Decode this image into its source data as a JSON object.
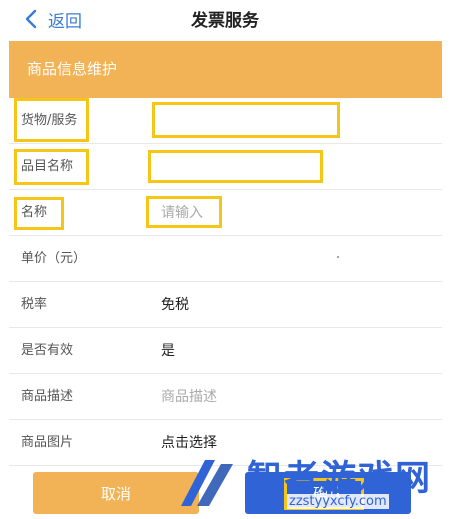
{
  "nav": {
    "back_label": "返回",
    "title": "发票服务"
  },
  "section": {
    "title": "商品信息维护"
  },
  "form": {
    "rows": [
      {
        "label": "货物/服务",
        "value": "",
        "placeholder": ""
      },
      {
        "label": "品目名称",
        "value": "",
        "placeholder": ""
      },
      {
        "label": "名称",
        "value": "",
        "placeholder": "请输入"
      },
      {
        "label": "单价（元）",
        "value": "",
        "placeholder": ""
      },
      {
        "label": "税率",
        "value": "免税",
        "placeholder": ""
      },
      {
        "label": "是否有效",
        "value": "是",
        "placeholder": ""
      },
      {
        "label": "商品描述",
        "value": "",
        "placeholder": "商品描述"
      },
      {
        "label": "商品图片",
        "value": "点击选择",
        "placeholder": ""
      }
    ]
  },
  "actions": {
    "cancel_label": "取消",
    "confirm_label": "确认"
  },
  "watermark": {
    "text": "智者游戏网",
    "url": "zzstyyxcfy.com"
  },
  "colors": {
    "accent_orange": "#f2b256",
    "accent_blue": "#2f63d6",
    "highlight": "#f5c518",
    "link": "#3b7bd6"
  }
}
